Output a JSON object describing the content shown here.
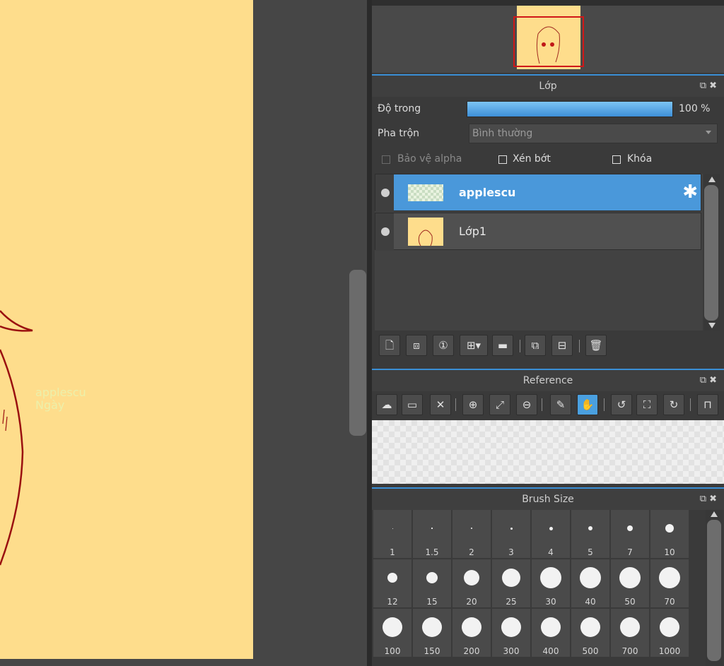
{
  "canvas": {
    "paper_color": "#fedd8c",
    "overlay_text_line1": "applescu",
    "overlay_text_line2": "Ngày"
  },
  "layer_panel": {
    "title": "Lớp",
    "opacity_label": "Độ trong",
    "opacity_value": "100 %",
    "opacity_fraction": 1.0,
    "blend_label": "Pha trộn",
    "blend_value": "Bình thường",
    "protect_alpha": "Bảo vệ alpha",
    "clipping": "Xén bớt",
    "lock": "Khóa",
    "layers": [
      {
        "name": "applescu",
        "selected": true
      },
      {
        "name": "Lớp1",
        "selected": false
      }
    ]
  },
  "reference_panel": {
    "title": "Reference"
  },
  "brush_panel": {
    "title": "Brush Size",
    "sizes": [
      "1",
      "1.5",
      "2",
      "3",
      "4",
      "5",
      "7",
      "10",
      "12",
      "15",
      "20",
      "25",
      "30",
      "40",
      "50",
      "70",
      "100",
      "150",
      "200",
      "300",
      "400",
      "500",
      "700",
      "1000"
    ]
  },
  "colors": {
    "accent": "#3a8fd6",
    "selected_layer": "#4a98da",
    "nav_frame": "#d01818"
  }
}
